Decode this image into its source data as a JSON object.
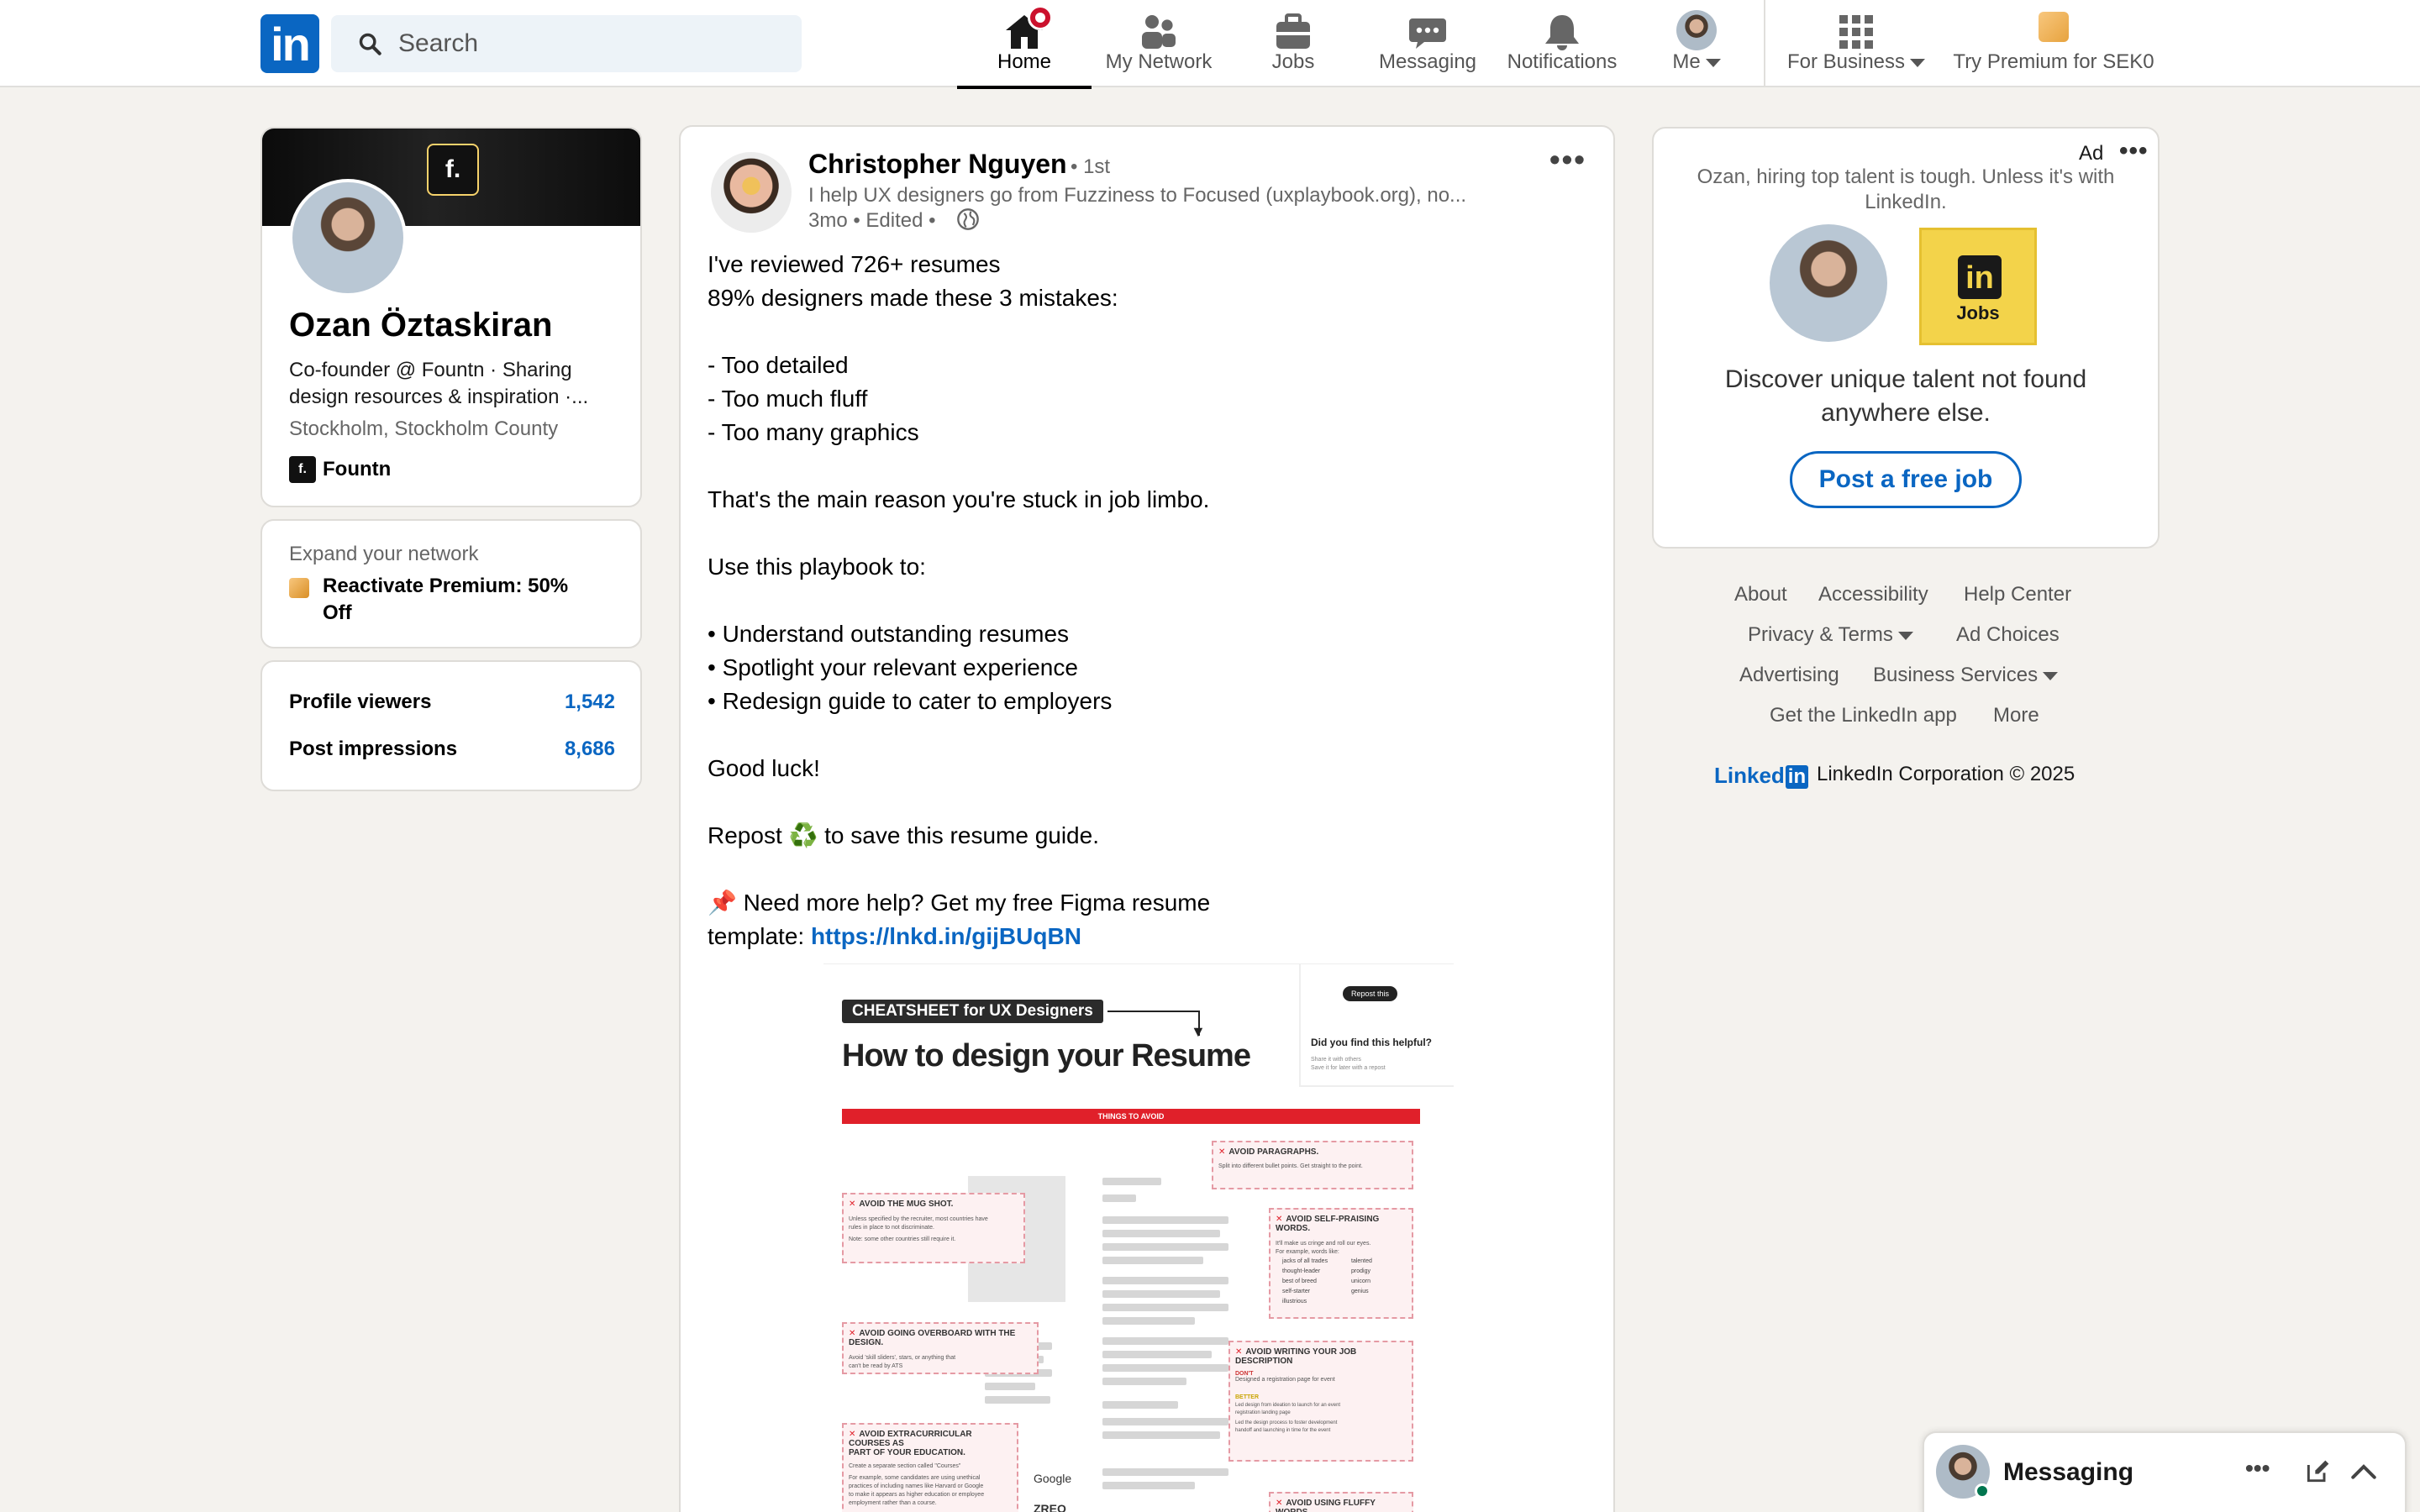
{
  "nav": {
    "logo_text": "in",
    "search_placeholder": "Search",
    "items": [
      {
        "label": "Home",
        "icon": "home-icon",
        "active": true
      },
      {
        "label": "My Network",
        "icon": "people-icon"
      },
      {
        "label": "Jobs",
        "icon": "briefcase-icon"
      },
      {
        "label": "Messaging",
        "icon": "chat-icon"
      },
      {
        "label": "Notifications",
        "icon": "bell-icon"
      },
      {
        "label": "Me",
        "icon": "avatar"
      },
      {
        "label": "For Business",
        "icon": "grid-icon"
      },
      {
        "label": "Try Premium for SEK0",
        "icon": "premium-icon"
      }
    ]
  },
  "profile": {
    "logo_text": "f.",
    "name": "Ozan Öztaskiran",
    "headline_1": "Co-founder @ Fountn · Sharing",
    "headline_2": "design resources & inspiration ·...",
    "location": "Stockholm, Stockholm County",
    "company": "Fountn",
    "company_logo_text": "f."
  },
  "network": {
    "label": "Expand your network",
    "premium_1": "Reactivate Premium: 50%",
    "premium_2": "Off"
  },
  "stats": [
    {
      "label": "Profile viewers",
      "value": "1,542"
    },
    {
      "label": "Post impressions",
      "value": "8,686"
    }
  ],
  "post": {
    "author": "Christopher Nguyen",
    "degree": "• 1st",
    "headline": "I help UX designers go from Fuzziness to Focused (uxplaybook.org), no...",
    "meta": "3mo • Edited •",
    "lines": [
      "I've reviewed 726+ resumes",
      "89% designers made these 3 mistakes:",
      "",
      "- Too detailed",
      "- Too much fluff",
      "- Too many graphics",
      "",
      "That's the main reason you're stuck in job limbo.",
      "",
      "Use this playbook to:",
      "",
      "• Understand outstanding resumes",
      "• Spotlight your relevant experience",
      "• Redesign guide to cater to employers",
      "",
      "Good luck!",
      "",
      "Repost ♻️ to save this resume guide.",
      "",
      "📌 Need more help? Get my free Figma resume"
    ],
    "last_line_prefix": "template: ",
    "link": "https://lnkd.in/gijBUqBN"
  },
  "resume_image": {
    "tag": "CHEATSHEET for UX Designers",
    "title": "How to design your Resume",
    "banner": "THINGS TO AVOID",
    "repost_chip": "Repost this",
    "helpful": "Did you find this helpful?",
    "helpful_sub_1": "Share it with others",
    "helpful_sub_2": "Save it for later with a repost",
    "avoid_paragraphs": "AVOID PARAGRAPHS.",
    "avoid_paragraphs_sub": "Split into different bullet points. Get straight to the point.",
    "avoid_mugshot": "AVOID THE MUG SHOT.",
    "avoid_mugshot_sub_1": "Unless specified by the recruiter, most countries have",
    "avoid_mugshot_sub_2": "rules in place to not discriminate.",
    "avoid_mugshot_sub_3": "Note: some other countries still require it.",
    "avoid_praising": "AVOID SELF-PRAISING WORDS.",
    "avoid_praising_sub_1": "It'll make us cringe and roll our eyes.",
    "avoid_praising_sub_2": "For example, words like:",
    "praise_words_left": [
      "jacks of all trades",
      "thought-leader",
      "best of breed",
      "self-starter",
      "illustrious"
    ],
    "praise_words_right": [
      "talented",
      "prodigy",
      "unicorn",
      "genius"
    ],
    "avoid_overboard": "AVOID GOING OVERBOARD WITH THE DESIGN.",
    "avoid_overboard_sub_1": "Avoid 'skill sliders', stars, or anything that",
    "avoid_overboard_sub_2": "can't be read by ATS",
    "avoid_jobdesc": "AVOID WRITING YOUR JOB DESCRIPTION",
    "dont": "DON'T",
    "dont_sub": "Designed a registration page for event",
    "better": "BETTER",
    "better_sub_1": "Led design from ideation to launch for an event",
    "better_sub_2": "registration landing page",
    "better_sub_3": "Led the design process to foster development",
    "better_sub_4": "handoff and launching in time for the event",
    "avoid_extra_1": "AVOID EXTRACURRICULAR COURSES AS",
    "avoid_extra_2": "PART OF YOUR EDUCATION.",
    "avoid_extra_sub_1": "Create a separate section called \"Courses\"",
    "avoid_extra_sub_2": "For example, some candidates are using unethical",
    "avoid_extra_sub_3": "practices of including names like Harvard or Google",
    "avoid_extra_sub_4": "to make it appears as higher education or employee",
    "avoid_extra_sub_5": "employment rather than a course.",
    "google": "Google",
    "dark_word": "ZREO",
    "avoid_fluffy": "AVOID USING FLUFFY WORDS."
  },
  "ad": {
    "ad_label": "Ad",
    "line_1": "Ozan, hiring top talent is tough. Unless it's with",
    "line_2": "LinkedIn.",
    "jobs_logo_text": "in",
    "jobs_label": "Jobs",
    "discover_1": "Discover unique talent not found",
    "discover_2": "anywhere else.",
    "button": "Post a free job"
  },
  "footer": {
    "row1": [
      "About",
      "Accessibility",
      "Help Center"
    ],
    "row2": [
      "Privacy & Terms",
      "Ad Choices"
    ],
    "row3": [
      "Advertising",
      "Business Services"
    ],
    "row4": [
      "Get the LinkedIn app",
      "More"
    ],
    "brand_word": "Linked",
    "brand_in": "in",
    "copyright": "LinkedIn Corporation © 2025"
  },
  "messaging": {
    "label": "Messaging"
  },
  "colors": {
    "brand": "#0a66c2",
    "page_bg": "#f4f2ee",
    "badge": "#cb112d",
    "premium_gold": "#f5a623"
  }
}
